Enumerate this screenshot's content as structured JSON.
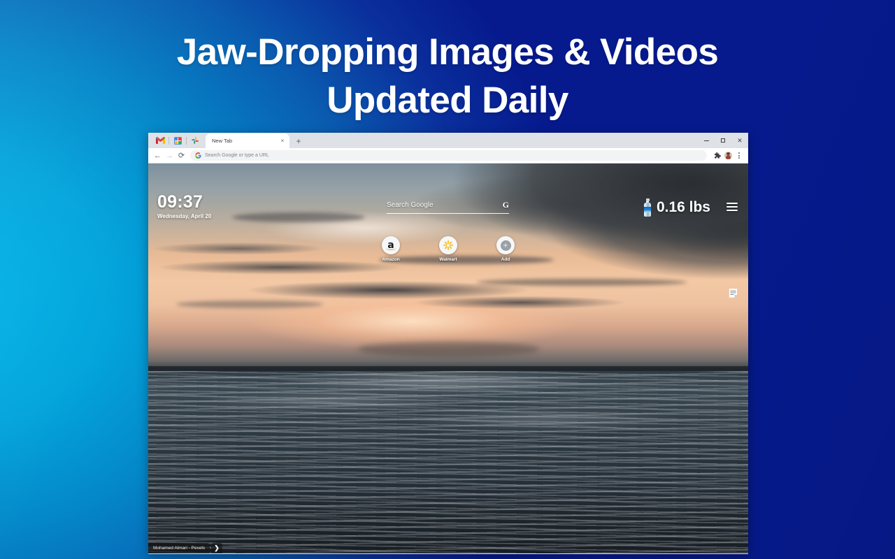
{
  "promo": {
    "headline_line1": "Jaw-Dropping Images & Videos",
    "headline_line2": "Updated Daily",
    "bg_color_left": "#02a8de",
    "bg_color_right": "#061389",
    "headline_color": "#ffffff"
  },
  "browser": {
    "pinned_tabs": [
      {
        "name": "gmail-pinned-tab",
        "icon": "gmail-icon"
      },
      {
        "name": "google-calendar-pinned-tab",
        "icon": "calendar-icon"
      },
      {
        "name": "google-photos-pinned-tab",
        "icon": "photos-icon"
      }
    ],
    "active_tab": {
      "title": "New Tab",
      "close_label": "×"
    },
    "new_tab_button_label": "+",
    "window_controls": {
      "minimize_label": "–",
      "maximize_label": "□",
      "close_label": "✕"
    },
    "toolbar": {
      "back_label": "←",
      "forward_label": "→",
      "reload_label": "⟳",
      "omnibox_placeholder": "Search Google or type a URL",
      "omnibox_value": "",
      "google_g": "G",
      "extensions_label": "Extensions",
      "profile_label": "Profile",
      "menu_label": "Customize and control Google Chrome"
    }
  },
  "newtab": {
    "clock": {
      "time": "09:37",
      "date": "Wednesday, April 20"
    },
    "search": {
      "placeholder": "Search Google",
      "value": "",
      "engine_glyph": "G"
    },
    "weight_widget": {
      "value": "0.16 lbs",
      "icon": "water-bottle-icon"
    },
    "menu_icon": "hamburger-menu-icon",
    "notes_icon": "sticky-note-icon",
    "shortcuts": [
      {
        "label": "Amazon",
        "icon": "amazon-icon",
        "glyph": "a"
      },
      {
        "label": "Walmart",
        "icon": "walmart-spark-icon",
        "glyph": ""
      },
      {
        "label": "Add",
        "icon": "plus-icon",
        "glyph": "+"
      }
    ],
    "photo_credit": {
      "text": "Mohamed Almari - Pexels",
      "next_label": "❯"
    },
    "background_photo": {
      "subject": "sunset over ocean with choppy water"
    }
  }
}
